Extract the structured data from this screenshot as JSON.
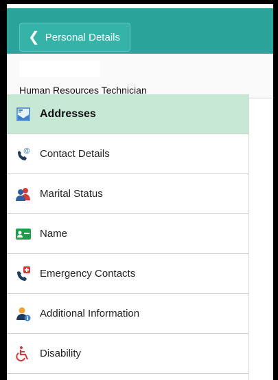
{
  "header": {
    "back_label": "Personal Details"
  },
  "profile": {
    "job_title": "Human Resources Technician"
  },
  "menu": {
    "items": [
      {
        "label": "Addresses",
        "icon": "addresses-icon",
        "active": true
      },
      {
        "label": "Contact Details",
        "icon": "contact-phone-icon",
        "active": false
      },
      {
        "label": "Marital Status",
        "icon": "couple-icon",
        "active": false
      },
      {
        "label": "Name",
        "icon": "id-card-icon",
        "active": false
      },
      {
        "label": "Emergency Contacts",
        "icon": "emergency-phone-icon",
        "active": false
      },
      {
        "label": "Additional Information",
        "icon": "person-info-icon",
        "active": false
      },
      {
        "label": "Disability",
        "icon": "wheelchair-icon",
        "active": false
      }
    ]
  },
  "colors": {
    "header": "#2aa39a",
    "active_row": "#c8e8d6"
  }
}
